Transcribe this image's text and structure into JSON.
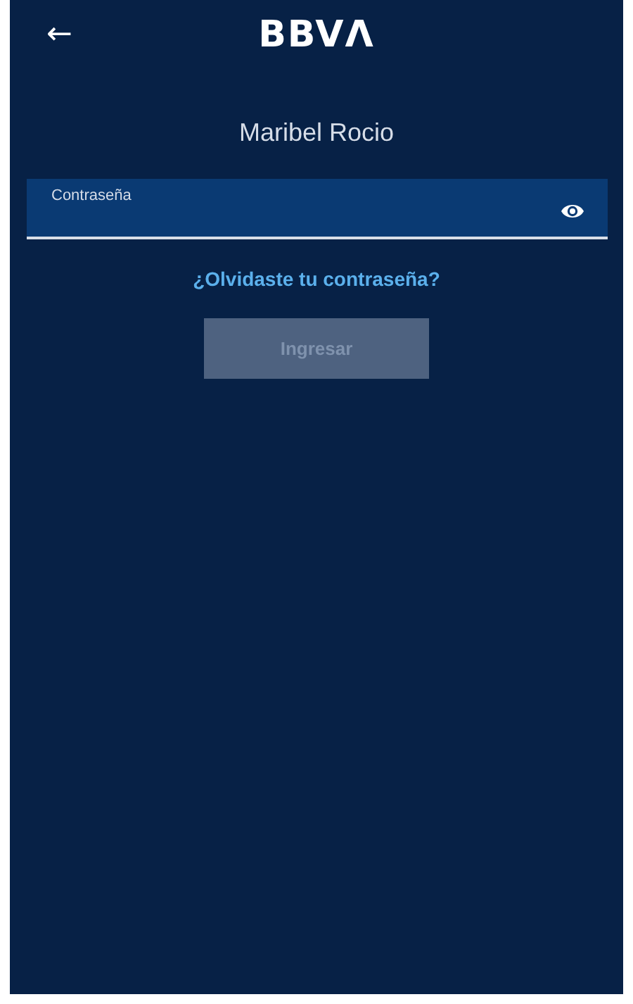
{
  "header": {
    "back": "←",
    "logo": "BBVΛ"
  },
  "user_name": "Maribel Rocio",
  "password_field": {
    "label": "Contraseña"
  },
  "forgot_link": "¿Olvidaste tu contraseña?",
  "submit_button": {
    "label": "Ingresar",
    "disabled": true
  }
}
